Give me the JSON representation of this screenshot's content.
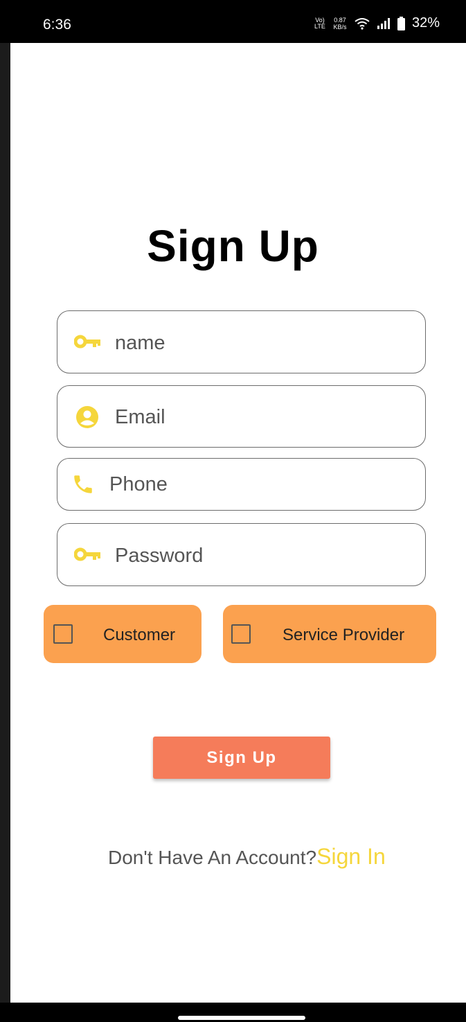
{
  "status_bar": {
    "time": "6:36",
    "network_label": "Vo) LTE",
    "speed_value": "0.87",
    "speed_unit": "KB/s",
    "battery": "32%"
  },
  "page": {
    "title": "Sign Up"
  },
  "form": {
    "name_placeholder": "name",
    "name_icon": "key-icon",
    "email_placeholder": "Email",
    "email_icon": "account-circle-icon",
    "phone_placeholder": "Phone",
    "phone_icon": "phone-icon",
    "password_placeholder": "Password",
    "password_icon": "key-icon"
  },
  "roles": {
    "customer_label": "Customer",
    "customer_checked": false,
    "provider_label": "Service Provider",
    "provider_checked": false
  },
  "actions": {
    "signup_label": "Sign Up"
  },
  "footer": {
    "prompt": "Don't Have An Account?",
    "link": "Sign In"
  },
  "colors": {
    "accent_icon": "#f5d63c",
    "role_button": "#fba14f",
    "signup_button": "#f57c5a",
    "link": "#f5d63c"
  }
}
